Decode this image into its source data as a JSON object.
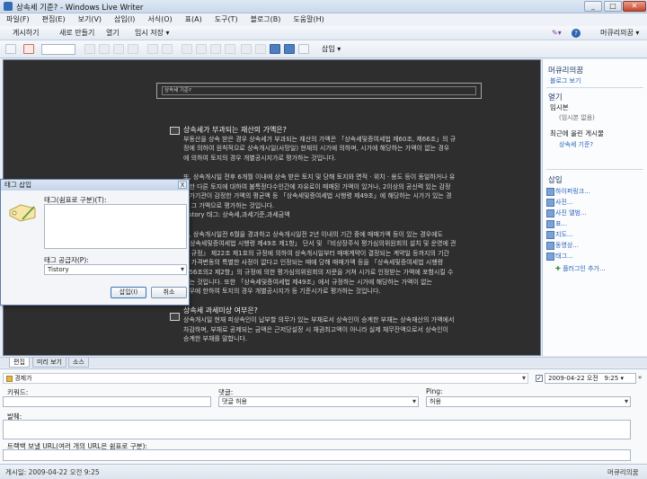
{
  "window": {
    "title": "상속세 기준? - Windows Live Writer"
  },
  "menu": [
    "파일(F)",
    "편집(E)",
    "보기(V)",
    "삽입(I)",
    "서식(O)",
    "표(A)",
    "도구(T)",
    "블로그(B)",
    "도움말(H)"
  ],
  "command_bar": {
    "publish": "게시하기",
    "new": "새로 만들기",
    "open": "열기",
    "save_draft": "임시 저장",
    "blog_name": "머큐리의꿈",
    "help": "?"
  },
  "format_toolbar": {
    "insert_label": "삽입"
  },
  "editor": {
    "post_title": "상속세 기준?",
    "lines": [
      {
        "t": "상속세가 부과되는 재산의 가액은?",
        "h": true
      },
      {
        "t": "부동산을 상속 받은 경우 상속세가 부과되는 재산의 가액은 「상속세및증여세법 제60조, 제66조」의 규"
      },
      {
        "t": "정에 의하여 원칙적으로 상속개시일(사망일) 현재의 시가에 의하며, 시가에 해당하는 가액이 없는 경우"
      },
      {
        "t": "에 의하여 토지의 경우 개별공시지가로 평가하는 것입니다."
      },
      {
        "t": ""
      },
      {
        "t": "또, 상속개시일 전후 6개월 이내에 상속 받은 토지 및 당해 토지와 면적 · 위치 · 용도 등이 동일하거나 유"
      },
      {
        "t": "사한 다른 토지에 대하여 불특정다수인간에 자유로이 매매된 가액이 있거나, 2이상의 공신력 있는 감정"
      },
      {
        "t": "평가기관이 감정한 가액의 평균액 등 「상속세및증여세법 시행령 제49조」에 해당하는 시가가 있는 경"
      },
      {
        "t": "우 그 가액으로 평가하는 것입니다."
      },
      {
        "t": "Tistory 태그: 상속세,과세기준,과세금액"
      },
      {
        "t": ""
      },
      {
        "t": "또, 상속개시일전 6월을 경과하고 상속개시일전 2년 이내의 기간 중에 매매가액 등이 있는 경우에도"
      },
      {
        "t": "「상속세및증여세법 시행령 제49조 제1항」 단서 및 『비상장주식 평가심의위원회의 설치 및 운영에 관"
      },
      {
        "t": "한 규정』 제22조 제1호의 규정에 의하여 상속개시일부터 매매계약이 결정되는 계약일 등까지의 기간"
      },
      {
        "t": "중 가격변동의 특별한 사정이 없다고 인정되는 때에 당해 매매가액 등을 「상속세및증여세법 시행령"
      },
      {
        "t": "제56조의2 제2항」의 규정에 의한 평가심의위원회의 자문을 거쳐 시가로 인정받는 가액에 포함시킬 수"
      },
      {
        "t": "있는 것입니다. 또한 「상속세및증여세법 제49조」에서 규정하는 시가에 해당하는 가액이 없는"
      },
      {
        "t": "경우에 한하여 토지의 경우 개별공시지가 등 기준시가로 평가하는 것입니다."
      },
      {
        "t": ""
      },
      {
        "t": "상속세 과세미상 여부은?",
        "h": true
      },
      {
        "t": "상속개시일 현재 피상속인이 납부할 의무가 있는 부채로서 상속인이 승계한 부채는 상속재산의 가액에서"
      },
      {
        "t": "차감하며, 부채로 공제되는 금액은 근저당설정 시 채권최고액이 아니라 실제 채무잔액으로서 상속인이"
      },
      {
        "t": "승계한 부채를 말합니다."
      }
    ]
  },
  "sidebar": {
    "blog_title": "머큐리의꿈",
    "blog_link": "블로그 보기",
    "open_title": "열기",
    "temp_posts": "임시본",
    "temp_none": "(임시본 없음)",
    "recent_posts": "최근에 올린 게시물",
    "recent_item": "상속세 기준?",
    "insert_title": "삽입",
    "insert_items": [
      "하이퍼링크...",
      "사진...",
      "사진 앨범...",
      "표...",
      "지도...",
      "동영상...",
      "태그..."
    ],
    "plugin_add": "플러그인 추가..."
  },
  "tabs": [
    "편집",
    "미리 보기",
    "소스"
  ],
  "properties": {
    "category": "경제가",
    "date_checked": true,
    "date": "2009-04-22 오전",
    "time": "9:25",
    "keywords_label": "키워드:",
    "comments_label": "댓글:",
    "comments_value": "댓글 허용",
    "ping_label": "Ping:",
    "ping_value": "허용",
    "excerpt_label": "발췌:",
    "trackback_label": "트랙백 보낼 URL(여러 개의 URL은 쉼표로 구분):"
  },
  "status": {
    "published": "게시일: 2009-04-22 오전 9:25",
    "blog": "머큐리의꿈"
  },
  "dialog": {
    "title": "태그 삽입",
    "close": "X",
    "tags_label": "태그(쉼표로 구분)(T):",
    "provider_label": "태그 공급자(P):",
    "provider_value": "Tistory",
    "insert_button": "삽입(I)",
    "cancel_button": "취소"
  },
  "colors": {
    "accent": "#2a62b8",
    "editor_bg": "#2e2e2e",
    "title_bar": "#c9d8ea"
  }
}
